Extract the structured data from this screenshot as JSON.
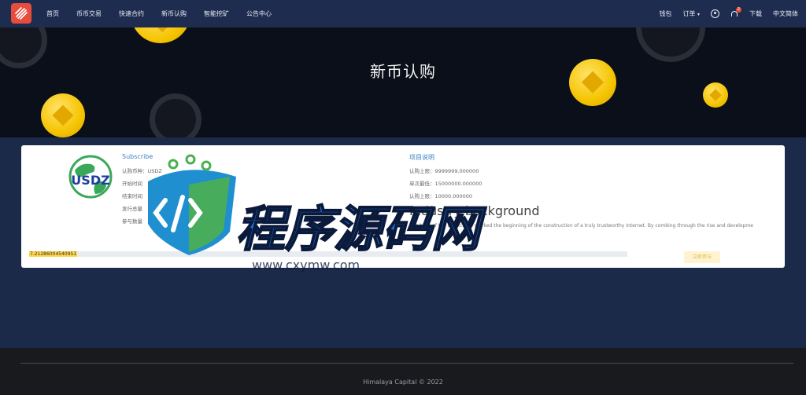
{
  "nav": {
    "links": [
      "首页",
      "币币交易",
      "快速合约",
      "新币认购",
      "智能挖矿",
      "公告中心"
    ],
    "wallet": "钱包",
    "orders": "订单",
    "notification_count": "2",
    "download": "下载",
    "language": "中文简体"
  },
  "hero": {
    "title": "新币认购"
  },
  "card": {
    "logo_text": "USDZ",
    "subscribe_title": "Subscribe",
    "subscribe_rows": [
      "认购币种：USDZ",
      "开始时间",
      "结束时间",
      "发行总量",
      "参与数量"
    ],
    "project_title": "项目说明",
    "project_rows": [
      "认购上限：9999999.000000",
      "单次最低：15000000.000000",
      "认购上限：10000.000000"
    ],
    "industry_title": "Industry background",
    "industry_desc": "The birth of the blockchain marked the beginning of the construction of a truly trustworthy Internet. By combing through the rise and developme",
    "progress_value": "7.21286004540951",
    "buy_label": "立即参与"
  },
  "watermark": {
    "text": "程序源码网",
    "url": "www.cxymw.com"
  },
  "footer": {
    "copyright": "Himalaya Capital © 2022"
  },
  "colors": {
    "nav_bg": "#1e2c50",
    "page_bg": "#1c2a4a",
    "accent": "#3b82c4",
    "coin": "#f5c400"
  }
}
